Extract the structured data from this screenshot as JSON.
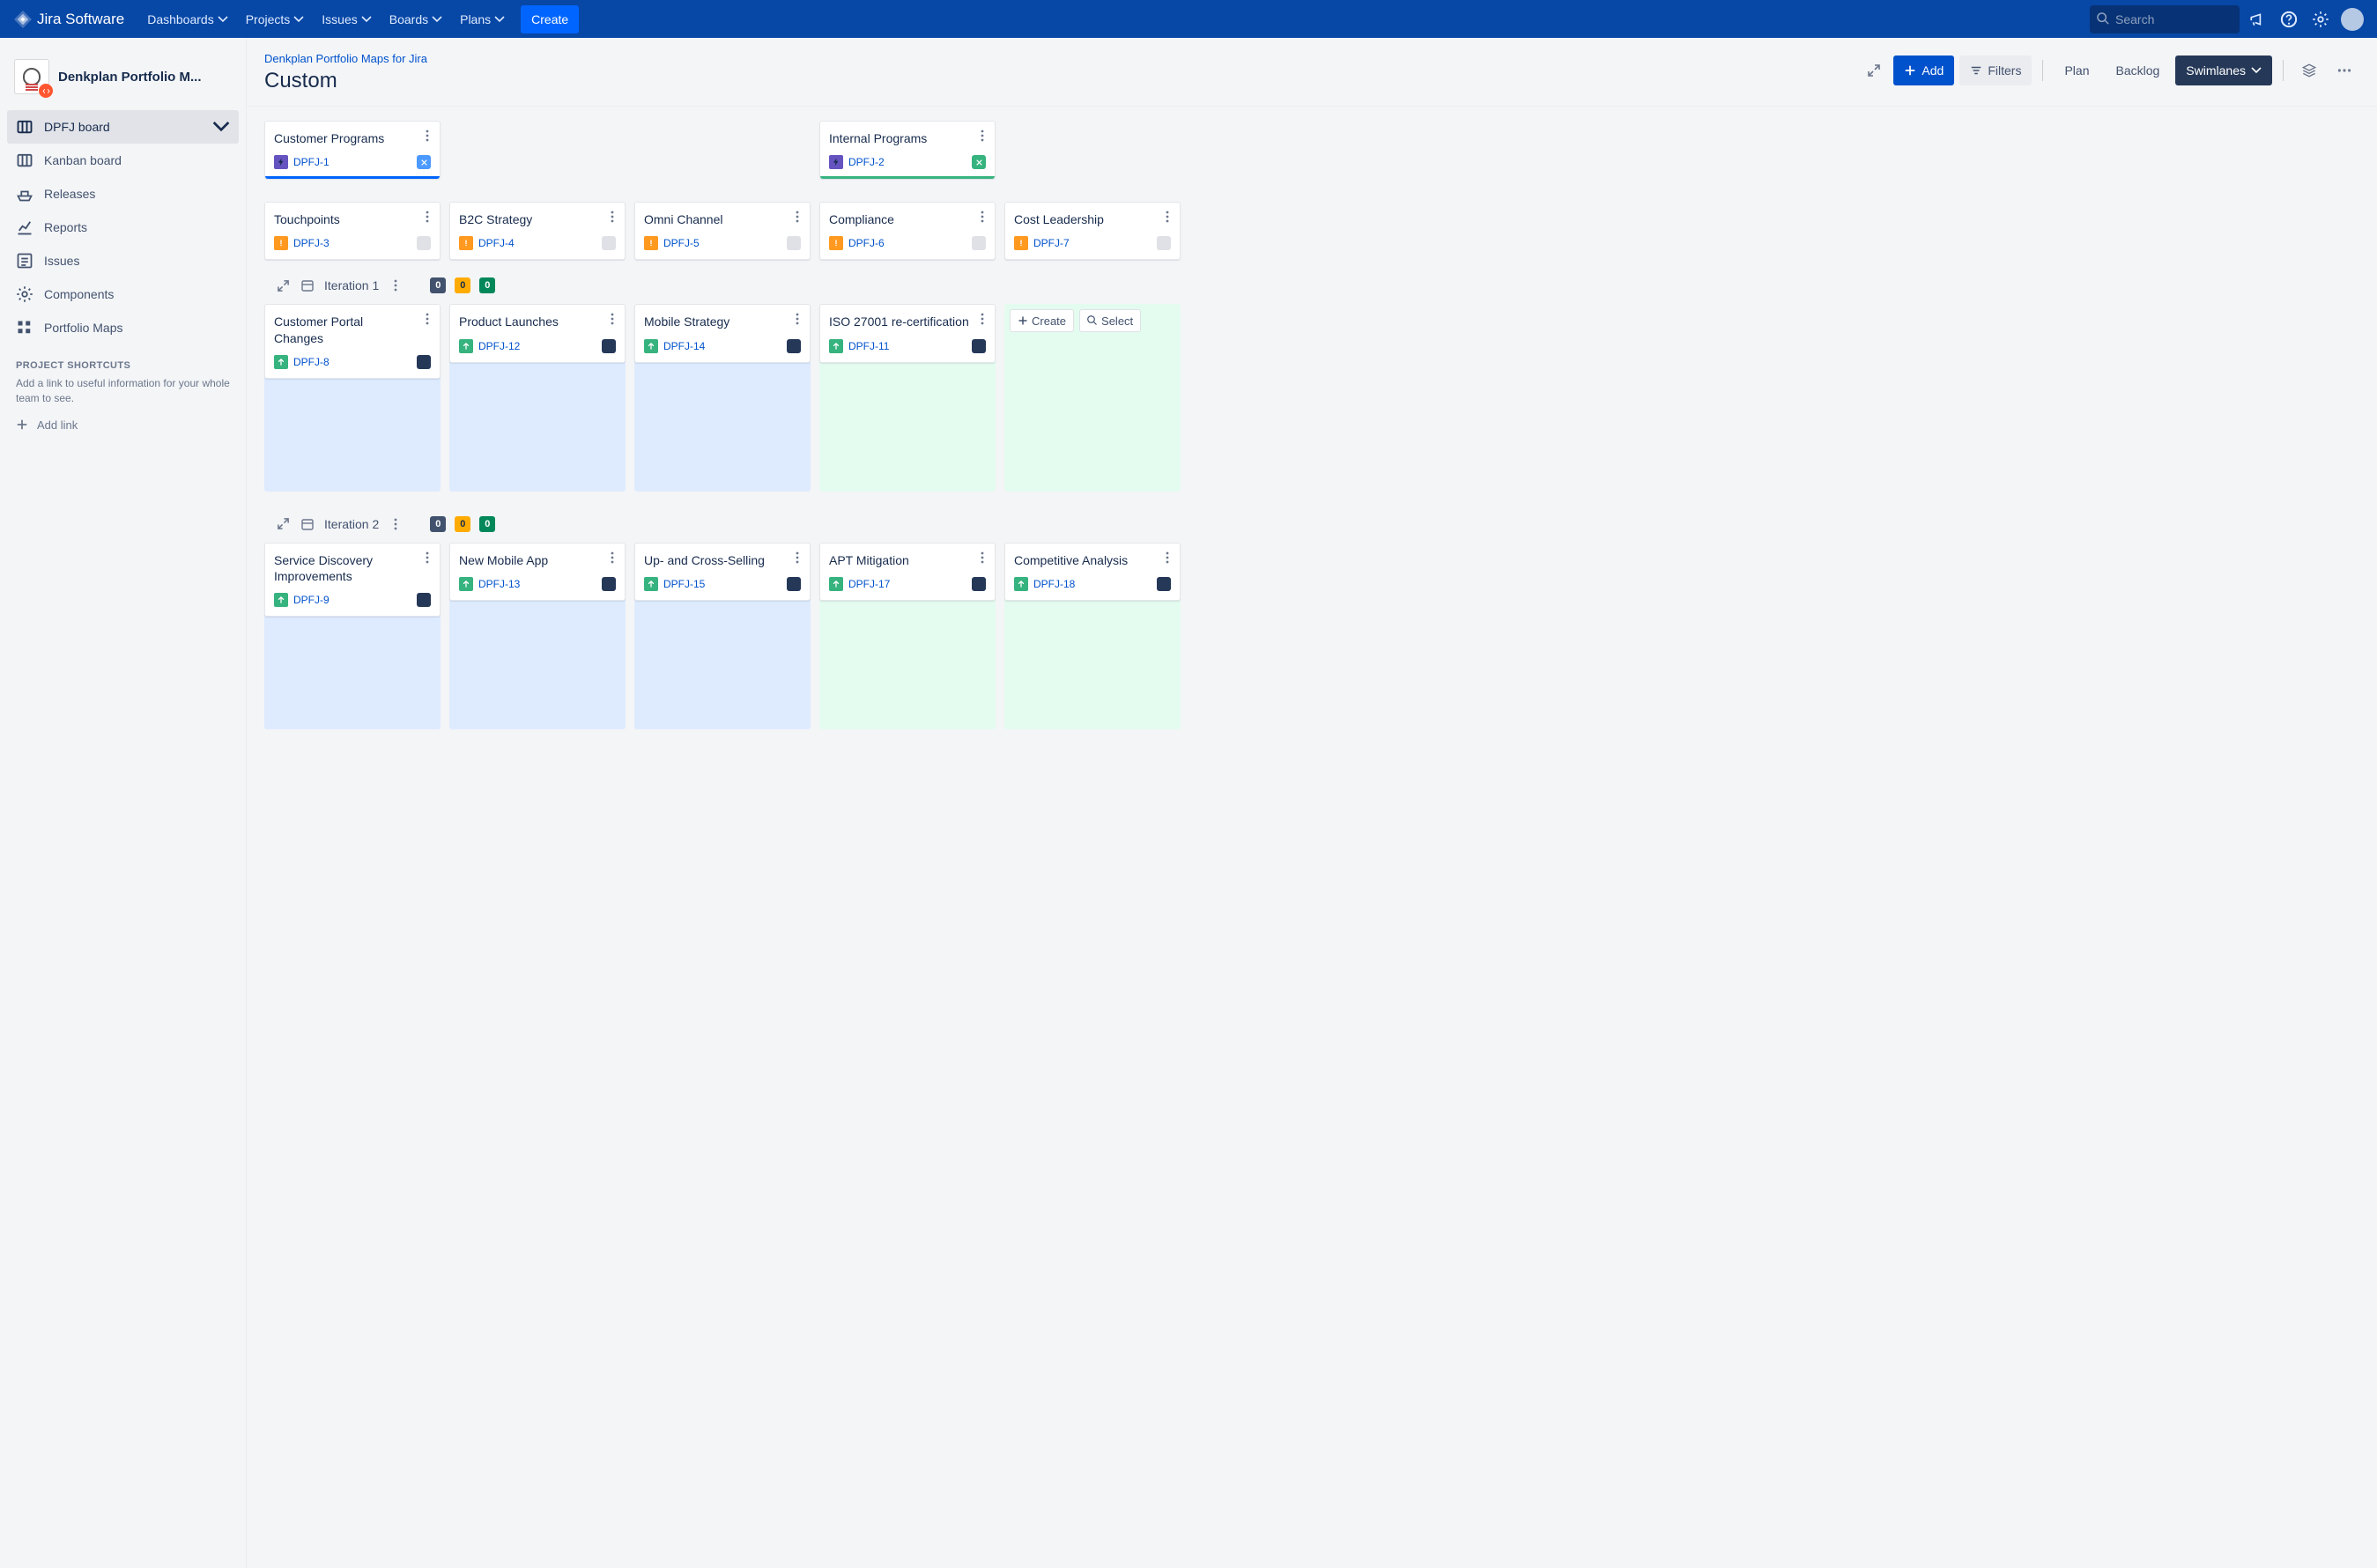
{
  "app_name": "Jira Software",
  "topnav": {
    "items": [
      "Dashboards",
      "Projects",
      "Issues",
      "Boards",
      "Plans"
    ],
    "create": "Create",
    "search_placeholder": "Search"
  },
  "project": {
    "name": "Denkplan Portfolio M..."
  },
  "sidebar": {
    "items": [
      {
        "label": "DPFJ board"
      },
      {
        "label": "Kanban board"
      },
      {
        "label": "Releases"
      },
      {
        "label": "Reports"
      },
      {
        "label": "Issues"
      },
      {
        "label": "Components"
      },
      {
        "label": "Portfolio Maps"
      }
    ],
    "shortcuts_heading": "PROJECT SHORTCUTS",
    "shortcuts_help": "Add a link to useful information for your whole team to see.",
    "add_link": "Add link"
  },
  "page": {
    "breadcrumb": "Denkplan Portfolio Maps for Jira",
    "title": "Custom"
  },
  "toolbar": {
    "add": "Add",
    "filters": "Filters",
    "plan": "Plan",
    "backlog": "Backlog",
    "swimlanes": "Swimlanes"
  },
  "programs": [
    {
      "title": "Customer Programs",
      "key": "DPFJ-1",
      "bar_color": "#0065FF",
      "tag": "remove"
    },
    {
      "title": "Internal Programs",
      "key": "DPFJ-2",
      "bar_color": "#36B37E",
      "tag": "green"
    }
  ],
  "epics": [
    {
      "title": "Touchpoints",
      "key": "DPFJ-3"
    },
    {
      "title": "B2C Strategy",
      "key": "DPFJ-4"
    },
    {
      "title": "Omni Channel",
      "key": "DPFJ-5"
    },
    {
      "title": "Compliance",
      "key": "DPFJ-6"
    },
    {
      "title": "Cost Leadership",
      "key": "DPFJ-7"
    }
  ],
  "iterations": [
    {
      "label": "Iteration 1",
      "counts": [
        "0",
        "0",
        "0"
      ],
      "lanes": [
        {
          "title": "Customer Portal Changes",
          "key": "DPFJ-8",
          "tone": "blue"
        },
        {
          "title": "Product Launches",
          "key": "DPFJ-12",
          "tone": "blue"
        },
        {
          "title": "Mobile Strategy",
          "key": "DPFJ-14",
          "tone": "blue"
        },
        {
          "title": "ISO 27001 re-certification",
          "key": "DPFJ-11",
          "tone": "green"
        },
        {
          "type": "select",
          "create": "Create",
          "select": "Select",
          "tone": "green"
        }
      ]
    },
    {
      "label": "Iteration 2",
      "counts": [
        "0",
        "0",
        "0"
      ],
      "lanes": [
        {
          "title": "Service Discovery Improvements",
          "key": "DPFJ-9",
          "tone": "blue"
        },
        {
          "title": "New Mobile App",
          "key": "DPFJ-13",
          "tone": "blue"
        },
        {
          "title": "Up- and Cross-Selling",
          "key": "DPFJ-15",
          "tone": "blue"
        },
        {
          "title": "APT Mitigation",
          "key": "DPFJ-17",
          "tone": "green"
        },
        {
          "title": "Competitive Analysis",
          "key": "DPFJ-18",
          "tone": "green"
        }
      ]
    }
  ]
}
